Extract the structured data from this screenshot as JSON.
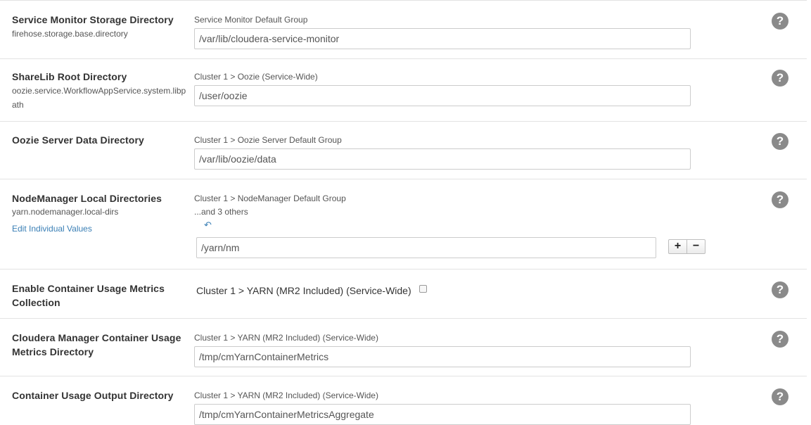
{
  "rows": [
    {
      "title": "Service Monitor Storage Directory",
      "property": "firehose.storage.base.directory",
      "scope": "Service Monitor Default Group",
      "value": "/var/lib/cloudera-service-monitor"
    },
    {
      "title": "ShareLib Root Directory",
      "property": "oozie.service.WorkflowAppService.system.libpath",
      "scope": "Cluster 1 > Oozie (Service-Wide)",
      "value": "/user/oozie"
    },
    {
      "title": "Oozie Server Data Directory",
      "scope": "Cluster 1 > Oozie Server Default Group",
      "value": "/var/lib/oozie/data"
    },
    {
      "title": "NodeManager Local Directories",
      "property": "yarn.nodemanager.local-dirs",
      "edit_link": "Edit Individual Values",
      "scope": "Cluster 1 > NodeManager Default Group",
      "others": "...and 3 others",
      "value": "/yarn/nm",
      "add_button": "+",
      "remove_button": "−"
    },
    {
      "title": "Enable Container Usage Metrics Collection",
      "scope": "Cluster 1 > YARN (MR2 Included) (Service-Wide)",
      "checked": false
    },
    {
      "title": "Cloudera Manager Container Usage Metrics Directory",
      "scope": "Cluster 1 > YARN (MR2 Included) (Service-Wide)",
      "value": "/tmp/cmYarnContainerMetrics"
    },
    {
      "title": "Container Usage Output Directory",
      "scope": "Cluster 1 > YARN (MR2 Included) (Service-Wide)",
      "value": "/tmp/cmYarnContainerMetricsAggregate"
    }
  ],
  "help_icon": "?",
  "revert_icon": "↶"
}
